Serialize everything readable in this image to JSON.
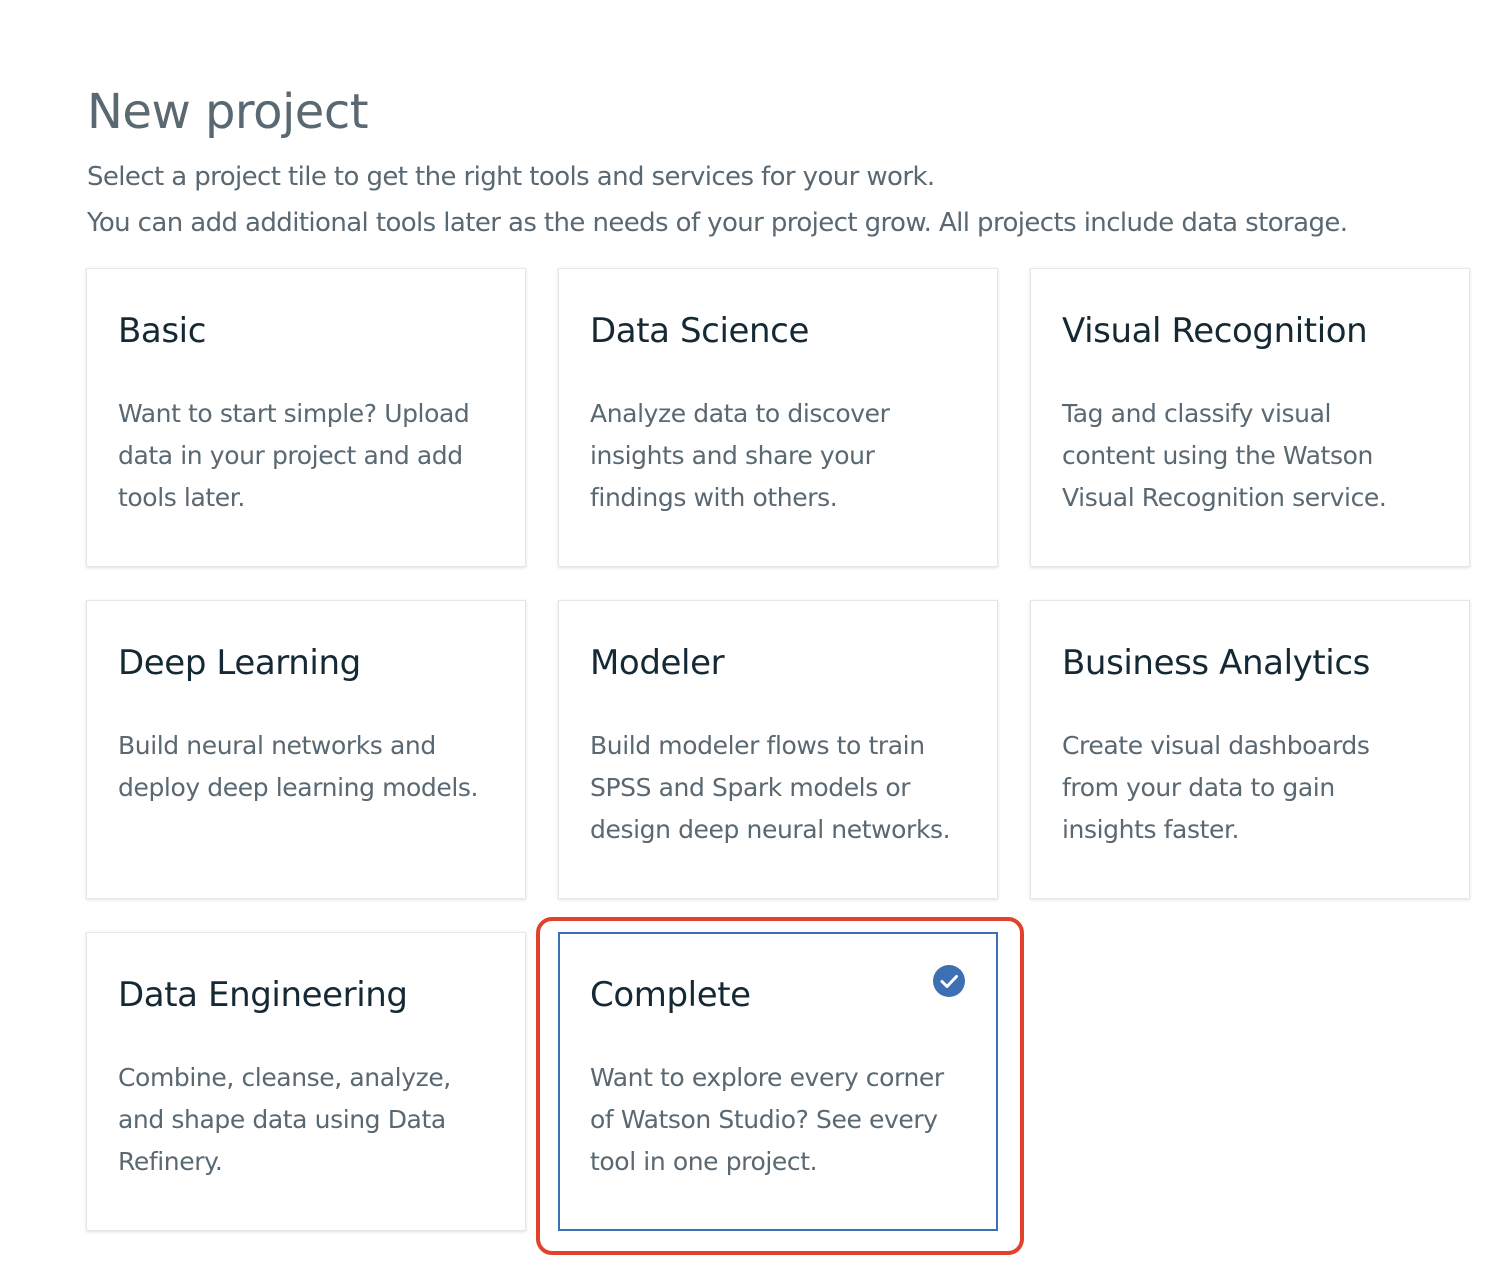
{
  "header": {
    "title": "New project",
    "subtitle_line1": "Select a project tile to get the right tools and services for your work.",
    "subtitle_line2": "You can add additional tools later as the needs of your project grow. All projects include data storage."
  },
  "tiles": [
    {
      "title": "Basic",
      "description": "Want to start simple? Upload\ndata in your project and add\ntools later.",
      "selected": false
    },
    {
      "title": "Data Science",
      "description": "Analyze data to discover\ninsights and share your\nfindings with others.",
      "selected": false
    },
    {
      "title": "Visual Recognition",
      "description": "Tag and classify visual\ncontent using the Watson\nVisual Recognition service.",
      "selected": false
    },
    {
      "title": "Deep Learning",
      "description": "Build neural networks and\ndeploy deep learning models.",
      "selected": false
    },
    {
      "title": "Modeler",
      "description": "Build modeler flows to train\nSPSS and Spark models or\ndesign deep neural networks.",
      "selected": false
    },
    {
      "title": "Business Analytics",
      "description": "Create visual dashboards\nfrom your data to gain\ninsights faster.",
      "selected": false
    },
    {
      "title": "Data Engineering",
      "description": "Combine, cleanse, analyze,\nand shape data using Data\nRefinery.",
      "selected": false
    },
    {
      "title": "Complete",
      "description": "Want to explore every corner\nof Watson Studio? See every\ntool in one project.",
      "selected": true,
      "icon": "checkmark-circle-icon"
    }
  ],
  "colors": {
    "selected_border": "#3d70b2",
    "check_fill": "#3d70b2",
    "annotation_highlight": "#e2412b",
    "title_text": "#152935",
    "body_text": "#5a6872"
  }
}
